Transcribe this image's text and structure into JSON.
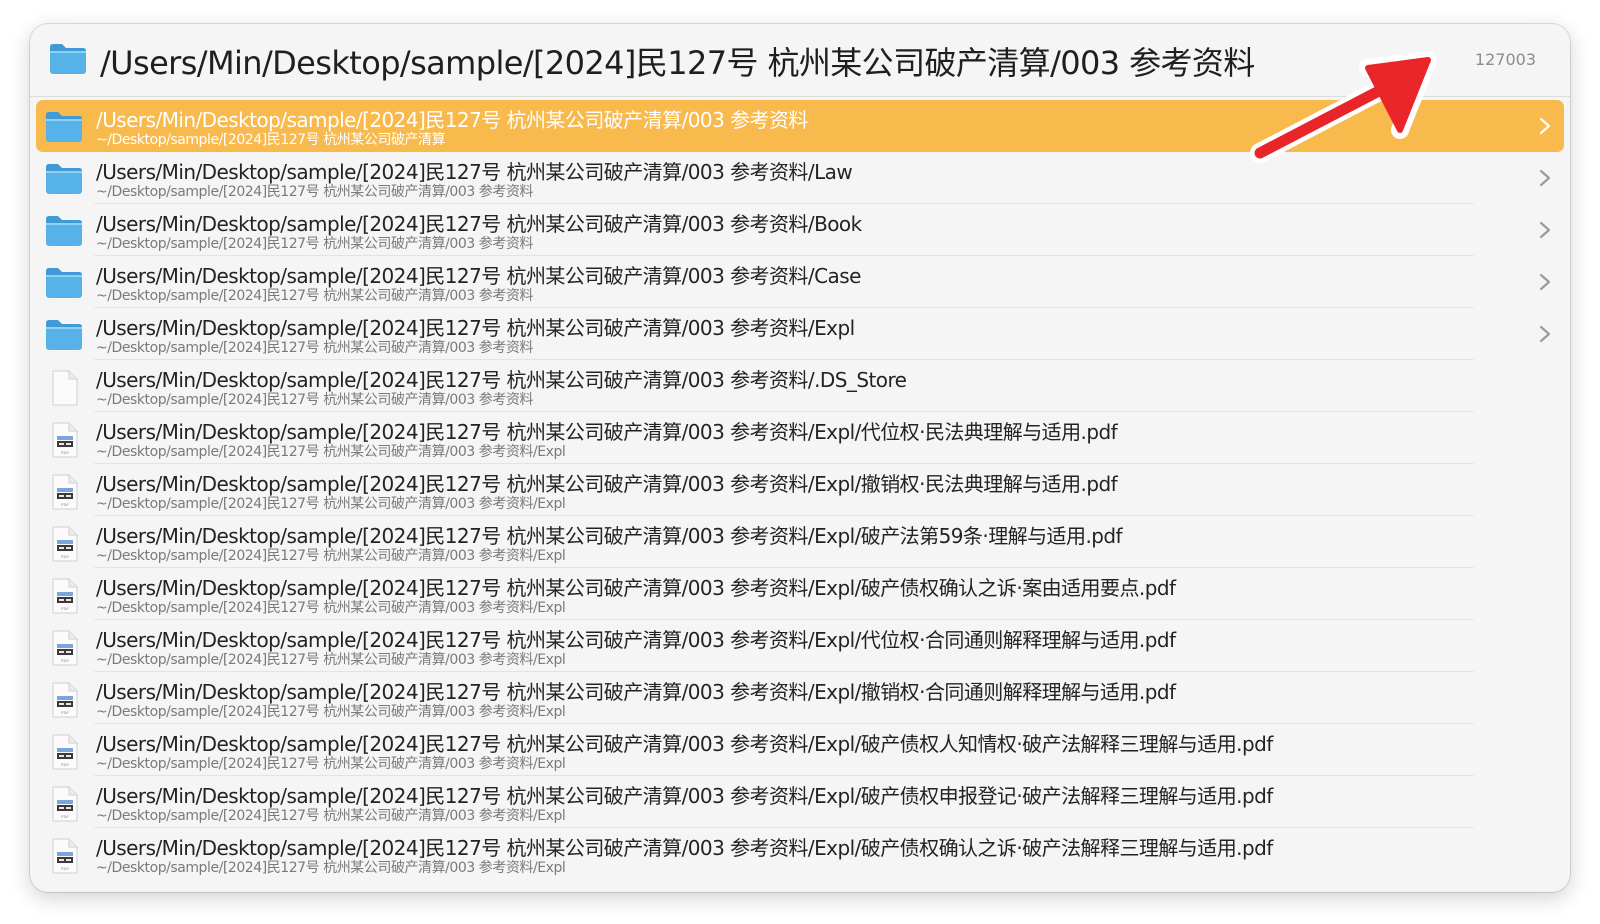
{
  "header": {
    "title": "/Users/Min/Desktop/sample/[2024]民127号 杭州某公司破产清算/003 参考资料",
    "count": "127003",
    "icon": "folder-icon"
  },
  "colors": {
    "selected": "#f8b94d",
    "folder": "#58b2ea",
    "arrow": "#e8262a"
  },
  "rows": [
    {
      "title": "/Users/Min/Desktop/sample/[2024]民127号 杭州某公司破产清算/003 参考资料",
      "subtitle": "~/Desktop/sample/[2024]民127号 杭州某公司破产清算",
      "icon": "folder-icon",
      "selected": true
    },
    {
      "title": "/Users/Min/Desktop/sample/[2024]民127号 杭州某公司破产清算/003 参考资料/Law",
      "subtitle": "~/Desktop/sample/[2024]民127号 杭州某公司破产清算/003 参考资料",
      "icon": "folder-icon"
    },
    {
      "title": "/Users/Min/Desktop/sample/[2024]民127号 杭州某公司破产清算/003 参考资料/Book",
      "subtitle": "~/Desktop/sample/[2024]民127号 杭州某公司破产清算/003 参考资料",
      "icon": "folder-icon"
    },
    {
      "title": "/Users/Min/Desktop/sample/[2024]民127号 杭州某公司破产清算/003 参考资料/Case",
      "subtitle": "~/Desktop/sample/[2024]民127号 杭州某公司破产清算/003 参考资料",
      "icon": "folder-icon"
    },
    {
      "title": "/Users/Min/Desktop/sample/[2024]民127号 杭州某公司破产清算/003 参考资料/Expl",
      "subtitle": "~/Desktop/sample/[2024]民127号 杭州某公司破产清算/003 参考资料",
      "icon": "folder-icon"
    },
    {
      "title": "/Users/Min/Desktop/sample/[2024]民127号 杭州某公司破产清算/003 参考资料/.DS_Store",
      "subtitle": "~/Desktop/sample/[2024]民127号 杭州某公司破产清算/003 参考资料",
      "icon": "blank-file-icon"
    },
    {
      "title": "/Users/Min/Desktop/sample/[2024]民127号 杭州某公司破产清算/003 参考资料/Expl/代位权·民法典理解与适用.pdf",
      "subtitle": "~/Desktop/sample/[2024]民127号 杭州某公司破产清算/003 参考资料/Expl",
      "icon": "pdf-file-icon"
    },
    {
      "title": "/Users/Min/Desktop/sample/[2024]民127号 杭州某公司破产清算/003 参考资料/Expl/撤销权·民法典理解与适用.pdf",
      "subtitle": "~/Desktop/sample/[2024]民127号 杭州某公司破产清算/003 参考资料/Expl",
      "icon": "pdf-file-icon"
    },
    {
      "title": "/Users/Min/Desktop/sample/[2024]民127号 杭州某公司破产清算/003 参考资料/Expl/破产法第59条·理解与适用.pdf",
      "subtitle": "~/Desktop/sample/[2024]民127号 杭州某公司破产清算/003 参考资料/Expl",
      "icon": "pdf-file-icon"
    },
    {
      "title": "/Users/Min/Desktop/sample/[2024]民127号 杭州某公司破产清算/003 参考资料/Expl/破产债权确认之诉·案由适用要点.pdf",
      "subtitle": "~/Desktop/sample/[2024]民127号 杭州某公司破产清算/003 参考资料/Expl",
      "icon": "pdf-file-icon"
    },
    {
      "title": "/Users/Min/Desktop/sample/[2024]民127号 杭州某公司破产清算/003 参考资料/Expl/代位权·合同通则解释理解与适用.pdf",
      "subtitle": "~/Desktop/sample/[2024]民127号 杭州某公司破产清算/003 参考资料/Expl",
      "icon": "pdf-file-icon"
    },
    {
      "title": "/Users/Min/Desktop/sample/[2024]民127号 杭州某公司破产清算/003 参考资料/Expl/撤销权·合同通则解释理解与适用.pdf",
      "subtitle": "~/Desktop/sample/[2024]民127号 杭州某公司破产清算/003 参考资料/Expl",
      "icon": "pdf-file-icon"
    },
    {
      "title": "/Users/Min/Desktop/sample/[2024]民127号 杭州某公司破产清算/003 参考资料/Expl/破产债权人知情权·破产法解释三理解与适用.pdf",
      "subtitle": "~/Desktop/sample/[2024]民127号 杭州某公司破产清算/003 参考资料/Expl",
      "icon": "pdf-file-icon"
    },
    {
      "title": "/Users/Min/Desktop/sample/[2024]民127号 杭州某公司破产清算/003 参考资料/Expl/破产债权申报登记·破产法解释三理解与适用.pdf",
      "subtitle": "~/Desktop/sample/[2024]民127号 杭州某公司破产清算/003 参考资料/Expl",
      "icon": "pdf-file-icon"
    },
    {
      "title": "/Users/Min/Desktop/sample/[2024]民127号 杭州某公司破产清算/003 参考资料/Expl/破产债权确认之诉·破产法解释三理解与适用.pdf",
      "subtitle": "~/Desktop/sample/[2024]民127号 杭州某公司破产清算/003 参考资料/Expl",
      "icon": "pdf-file-icon"
    }
  ]
}
